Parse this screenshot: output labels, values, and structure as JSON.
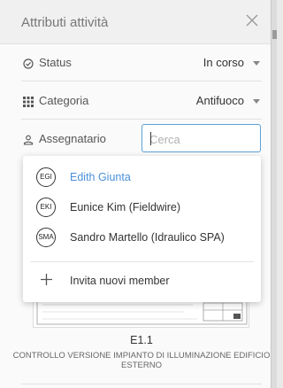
{
  "header": {
    "title": "Attributi attività",
    "close_icon": "close-icon"
  },
  "fields": {
    "status": {
      "label": "Status",
      "value": "In corso",
      "icon": "clock-icon"
    },
    "categoria": {
      "label": "Categoria",
      "value": "Antifuoco",
      "icon": "grid-icon"
    },
    "assegnatario": {
      "label": "Assegnatario",
      "icon": "person-icon",
      "placeholder": "Cerca",
      "value": ""
    }
  },
  "dropdown": {
    "items": [
      {
        "initials": "EGI",
        "name": "Edith Giunta",
        "active": true
      },
      {
        "initials": "EKI",
        "name": "Eunice Kim (Fieldwire)",
        "active": false
      },
      {
        "initials": "SMA",
        "name": "Sandro Martello (Idraulico SPA)",
        "active": false
      }
    ],
    "invite_label": "Invita nuovi member",
    "invite_icon": "plus-icon"
  },
  "sheet": {
    "number": "E1.1",
    "description": "CONTROLLO VERSIONE IMPIANTO DI ILLUMINAZIONE EDIFICIO ESTERNO"
  },
  "colors": {
    "accent": "#4a90d9",
    "focus_border": "#5aa0d8"
  }
}
